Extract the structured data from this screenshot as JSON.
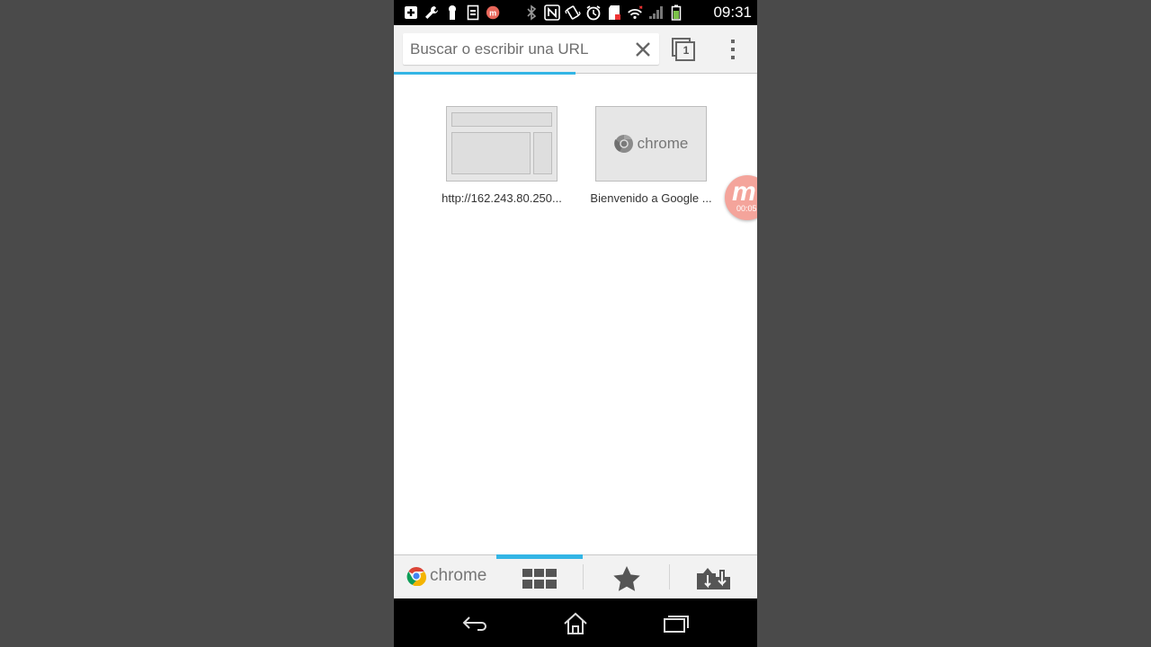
{
  "status_bar": {
    "time": "09:31",
    "icons": [
      "add-notification-icon",
      "wrench-icon",
      "usb-icon",
      "sim-icon",
      "recorder-icon",
      "bluetooth-icon",
      "nfc-icon",
      "vibrate-icon",
      "alarm-icon",
      "sd-card-icon",
      "wifi-icon",
      "signal-icon",
      "battery-icon"
    ]
  },
  "toolbar": {
    "url_placeholder": "Buscar o escribir una URL",
    "tab_count": "1"
  },
  "tiles": [
    {
      "caption": "http://162.243.80.250..."
    },
    {
      "caption": "Bienvenido a Google ...",
      "thumb_text": "chrome"
    }
  ],
  "recorder": {
    "letter": "m",
    "time": "00:05"
  },
  "bottom_bar": {
    "brand": "chrome",
    "active_tab": "most-visited",
    "buttons": [
      "most-visited-icon",
      "bookmarks-icon",
      "other-devices-icon"
    ]
  },
  "nav_bar": {
    "buttons": [
      "back-icon",
      "home-icon",
      "recent-apps-icon"
    ]
  },
  "colors": {
    "accent": "#33b5e5",
    "background": "#4a4a4a",
    "toolbar": "#f2f2f2"
  }
}
